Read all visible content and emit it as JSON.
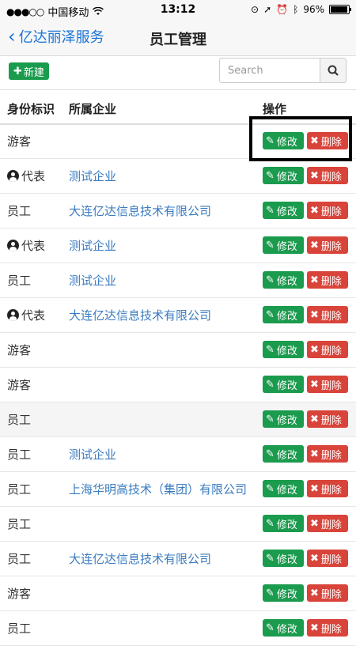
{
  "status_bar": {
    "carrier": "中国移动",
    "signal": "●●●○○",
    "time": "13:12",
    "battery": "96%"
  },
  "nav": {
    "back_label": "亿达丽泽服务",
    "title": "员工管理"
  },
  "toolbar": {
    "new_label": "新建",
    "search_placeholder": "Search"
  },
  "table": {
    "headers": {
      "identity": "身份标识",
      "company": "所属企业",
      "actions": "操作"
    },
    "edit_label": "修改",
    "delete_label": "删除",
    "rows": [
      {
        "identity": "游客",
        "rep": false,
        "company": ""
      },
      {
        "identity": "代表",
        "rep": true,
        "company": "测试企业"
      },
      {
        "identity": "员工",
        "rep": false,
        "company": "大连亿达信息技术有限公司"
      },
      {
        "identity": "代表",
        "rep": true,
        "company": "测试企业"
      },
      {
        "identity": "员工",
        "rep": false,
        "company": "测试企业"
      },
      {
        "identity": "代表",
        "rep": true,
        "company": "大连亿达信息技术有限公司"
      },
      {
        "identity": "游客",
        "rep": false,
        "company": ""
      },
      {
        "identity": "游客",
        "rep": false,
        "company": ""
      },
      {
        "identity": "员工",
        "rep": false,
        "company": "",
        "shaded": true
      },
      {
        "identity": "员工",
        "rep": false,
        "company": "测试企业"
      },
      {
        "identity": "员工",
        "rep": false,
        "company": "上海华明高技术（集团）有限公司"
      },
      {
        "identity": "员工",
        "rep": false,
        "company": ""
      },
      {
        "identity": "员工",
        "rep": false,
        "company": "大连亿达信息技术有限公司"
      },
      {
        "identity": "游客",
        "rep": false,
        "company": ""
      },
      {
        "identity": "员工",
        "rep": false,
        "company": ""
      }
    ]
  },
  "colors": {
    "accent_blue": "#1a73d9",
    "edit_green": "#1a9b4d",
    "delete_red": "#d9443a",
    "link_blue": "#3a7bbf"
  }
}
